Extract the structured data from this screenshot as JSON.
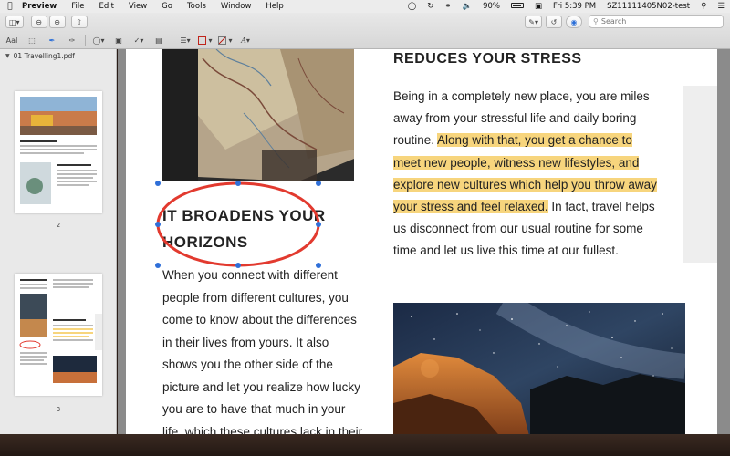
{
  "menubar": {
    "app_name": "Preview",
    "menus": [
      "File",
      "Edit",
      "View",
      "Go",
      "Tools",
      "Window",
      "Help"
    ],
    "battery": "90%",
    "clock": "Fri 5:39 PM",
    "user": "SZ11111405N02-test"
  },
  "toolbar": {
    "search_placeholder": "Search",
    "markup_text_tool": "AaI"
  },
  "sidebar": {
    "document_name": "01 Travelling1.pdf",
    "thumbnails": [
      {
        "page_label": "2"
      },
      {
        "page_label": "3"
      }
    ]
  },
  "document": {
    "left_heading": [
      "IT BROADENS YOUR",
      "HORIZONS"
    ],
    "left_paragraph": [
      "When you connect with different",
      "people from different cultures, you",
      "come to know about the differences",
      "in their lives from yours. It also",
      "shows you the other side of the",
      "picture and let you realize how lucky",
      "you are to have that much in your",
      "life, which these cultures lack in their"
    ],
    "right_heading": "REDUCES YOUR STRESS",
    "right_paragraph": {
      "line1": "Being in a completely new place, you are miles",
      "line2": "away from your stressful life and daily boring",
      "line3_plain": "routine. ",
      "line3_hl": "Along with that, you get a chance to",
      "line4_hl": "meet new people, witness new lifestyles, and",
      "line5_hl": "explore new cultures which help you throw away",
      "line6_hl": "your stress and feel relaxed.",
      "line6_plain": " In fact, travel helps",
      "line7": "us disconnect from our usual routine for some",
      "line8": "time and let us live this time at our fullest."
    },
    "annotation_color": "#e23a2f",
    "highlight_color": "#f7d57d"
  }
}
